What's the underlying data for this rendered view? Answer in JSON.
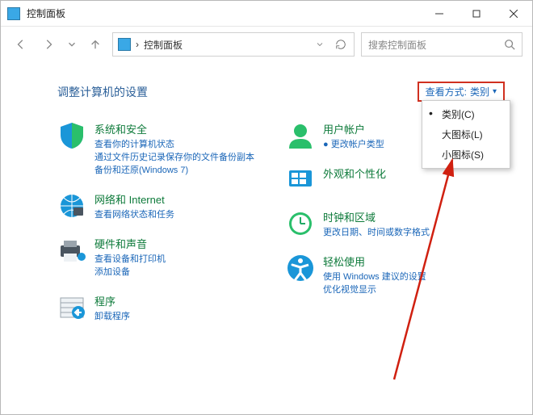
{
  "window": {
    "title": "控制面板"
  },
  "nav": {
    "breadcrumb": "控制面板",
    "separator": "›"
  },
  "search": {
    "placeholder": "搜索控制面板"
  },
  "heading": "调整计算机的设置",
  "viewby": {
    "label": "查看方式:",
    "value": "类别",
    "caret": "▾"
  },
  "menu": {
    "items": [
      {
        "label": "类别(C)",
        "selected": true
      },
      {
        "label": "大图标(L)",
        "selected": false
      },
      {
        "label": "小图标(S)",
        "selected": false
      }
    ]
  },
  "left": [
    {
      "title": "系统和安全",
      "links": [
        "查看你的计算机状态",
        "通过文件历史记录保存你的文件备份副本",
        "备份和还原(Windows 7)"
      ]
    },
    {
      "title": "网络和 Internet",
      "links": [
        "查看网络状态和任务"
      ]
    },
    {
      "title": "硬件和声音",
      "links": [
        "查看设备和打印机",
        "添加设备"
      ]
    },
    {
      "title": "程序",
      "links": [
        "卸载程序"
      ]
    }
  ],
  "right": [
    {
      "title": "用户帐户",
      "links": [
        "● 更改帐户类型"
      ]
    },
    {
      "title": "外观和个性化",
      "links": []
    },
    {
      "title": "时钟和区域",
      "links": [
        "更改日期、时间或数字格式"
      ]
    },
    {
      "title": "轻松使用",
      "links": [
        "使用 Windows 建议的设置",
        "优化视觉显示"
      ]
    }
  ]
}
